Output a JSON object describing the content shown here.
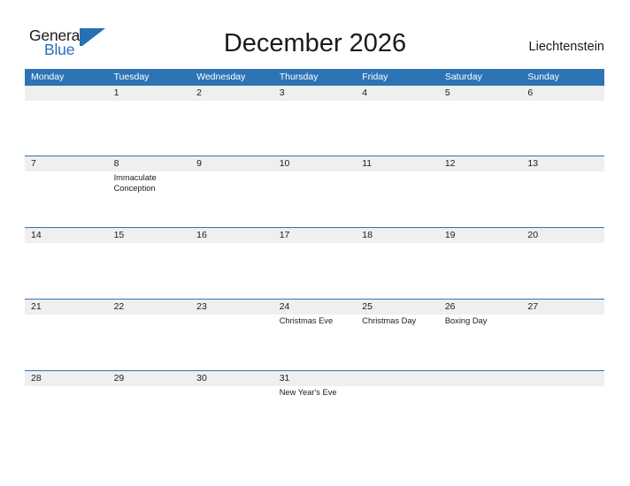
{
  "brand": {
    "name_part1": "General",
    "name_part2": "Blue",
    "mark": "flag-triangle-icon",
    "accent_color": "#2670b3"
  },
  "header": {
    "title": "December 2026",
    "region": "Liechtenstein"
  },
  "theme": {
    "header_blue": "#2e74b5",
    "number_band_gray": "#efefef",
    "text_dark": "#1b1b1b",
    "page_background": "#ffffff"
  },
  "calendar": {
    "month": "December",
    "year": "2026",
    "weekday_headers": [
      "Monday",
      "Tuesday",
      "Wednesday",
      "Thursday",
      "Friday",
      "Saturday",
      "Sunday"
    ],
    "weeks": [
      {
        "days": [
          {
            "number": "",
            "event": ""
          },
          {
            "number": "1",
            "event": ""
          },
          {
            "number": "2",
            "event": ""
          },
          {
            "number": "3",
            "event": ""
          },
          {
            "number": "4",
            "event": ""
          },
          {
            "number": "5",
            "event": ""
          },
          {
            "number": "6",
            "event": ""
          }
        ]
      },
      {
        "days": [
          {
            "number": "7",
            "event": ""
          },
          {
            "number": "8",
            "event": "Immaculate Conception"
          },
          {
            "number": "9",
            "event": ""
          },
          {
            "number": "10",
            "event": ""
          },
          {
            "number": "11",
            "event": ""
          },
          {
            "number": "12",
            "event": ""
          },
          {
            "number": "13",
            "event": ""
          }
        ]
      },
      {
        "days": [
          {
            "number": "14",
            "event": ""
          },
          {
            "number": "15",
            "event": ""
          },
          {
            "number": "16",
            "event": ""
          },
          {
            "number": "17",
            "event": ""
          },
          {
            "number": "18",
            "event": ""
          },
          {
            "number": "19",
            "event": ""
          },
          {
            "number": "20",
            "event": ""
          }
        ]
      },
      {
        "days": [
          {
            "number": "21",
            "event": ""
          },
          {
            "number": "22",
            "event": ""
          },
          {
            "number": "23",
            "event": ""
          },
          {
            "number": "24",
            "event": "Christmas Eve"
          },
          {
            "number": "25",
            "event": "Christmas Day"
          },
          {
            "number": "26",
            "event": "Boxing Day"
          },
          {
            "number": "27",
            "event": ""
          }
        ]
      },
      {
        "days": [
          {
            "number": "28",
            "event": ""
          },
          {
            "number": "29",
            "event": ""
          },
          {
            "number": "30",
            "event": ""
          },
          {
            "number": "31",
            "event": "New Year's Eve"
          },
          {
            "number": "",
            "event": ""
          },
          {
            "number": "",
            "event": ""
          },
          {
            "number": "",
            "event": ""
          }
        ]
      }
    ]
  }
}
